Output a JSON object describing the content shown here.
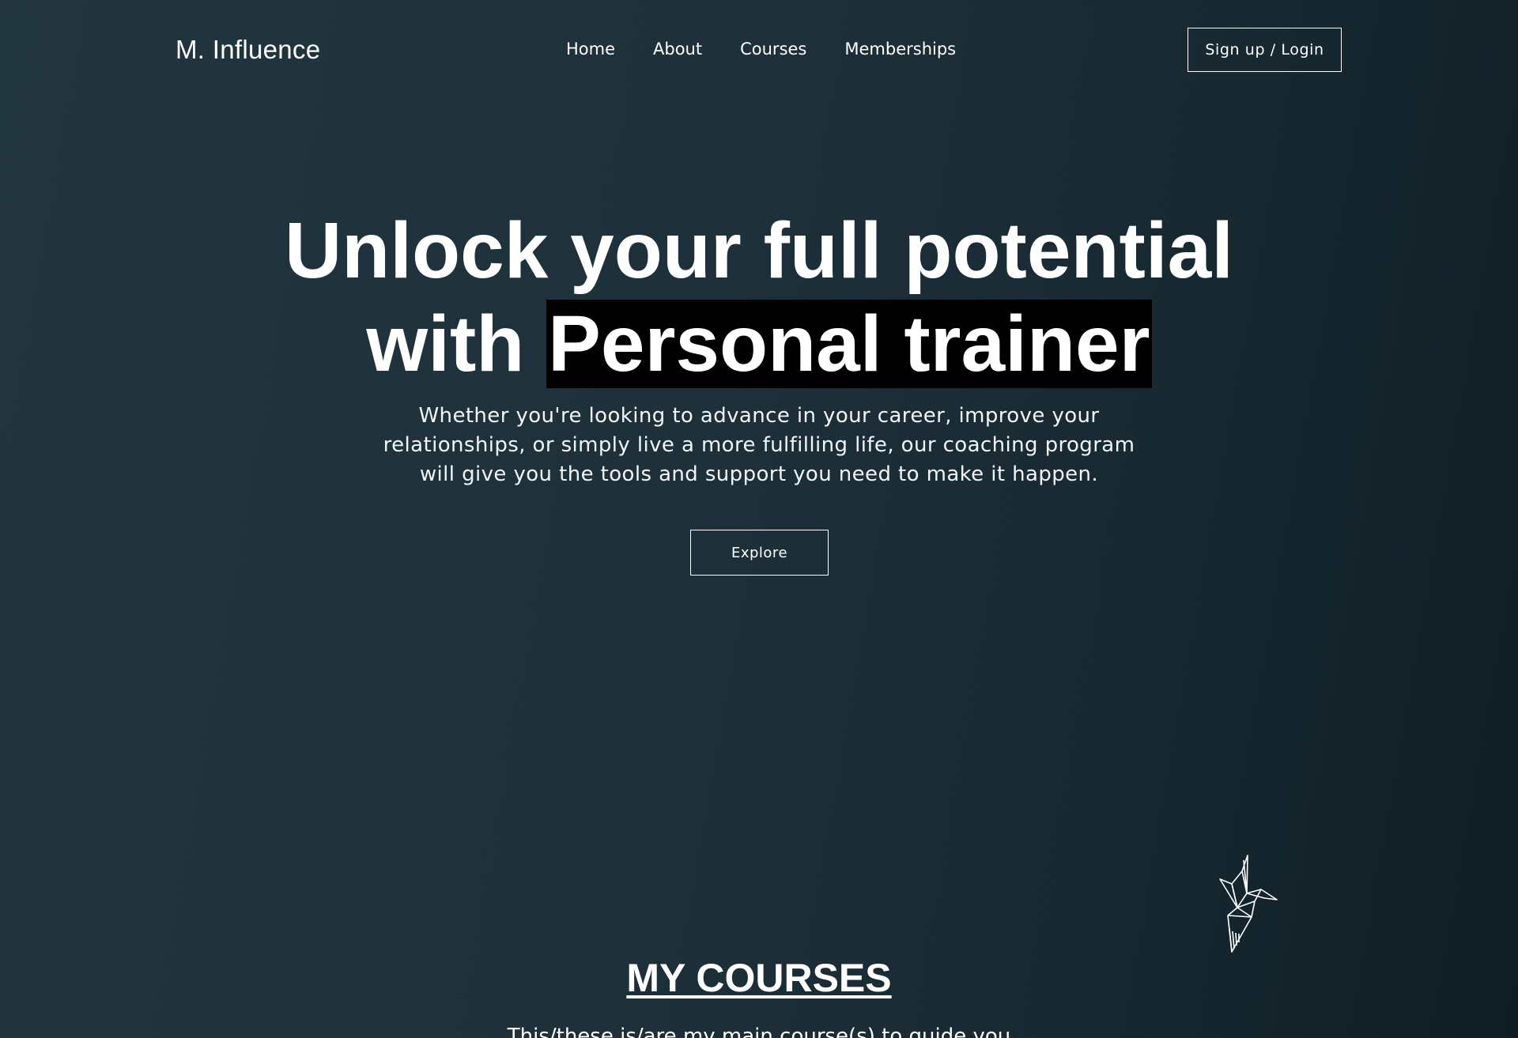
{
  "header": {
    "logo": "M. Influence",
    "nav": [
      {
        "label": "Home"
      },
      {
        "label": "About"
      },
      {
        "label": "Courses"
      },
      {
        "label": "Memberships"
      }
    ],
    "signup_label": "Sign up / Login"
  },
  "hero": {
    "title_line1": "Unlock your full potential",
    "title_line2_prefix": "with ",
    "title_line2_highlight": "Personal trainer",
    "subtitle": "Whether you're looking to advance in your career, improve your relationships, or simply live a more fulfilling life, our coaching program will give you the tools and support you need to make it happen.",
    "explore_label": "Explore"
  },
  "decor": {
    "icon": "origami-crane-icon"
  },
  "courses": {
    "title": "MY COURSES",
    "subtitle": "This/these is/are my main course(s) to guide you"
  },
  "colors": {
    "background_start": "#223640",
    "background_end": "#0f1d23",
    "highlight_bg": "#000000",
    "text": "#ffffff"
  }
}
